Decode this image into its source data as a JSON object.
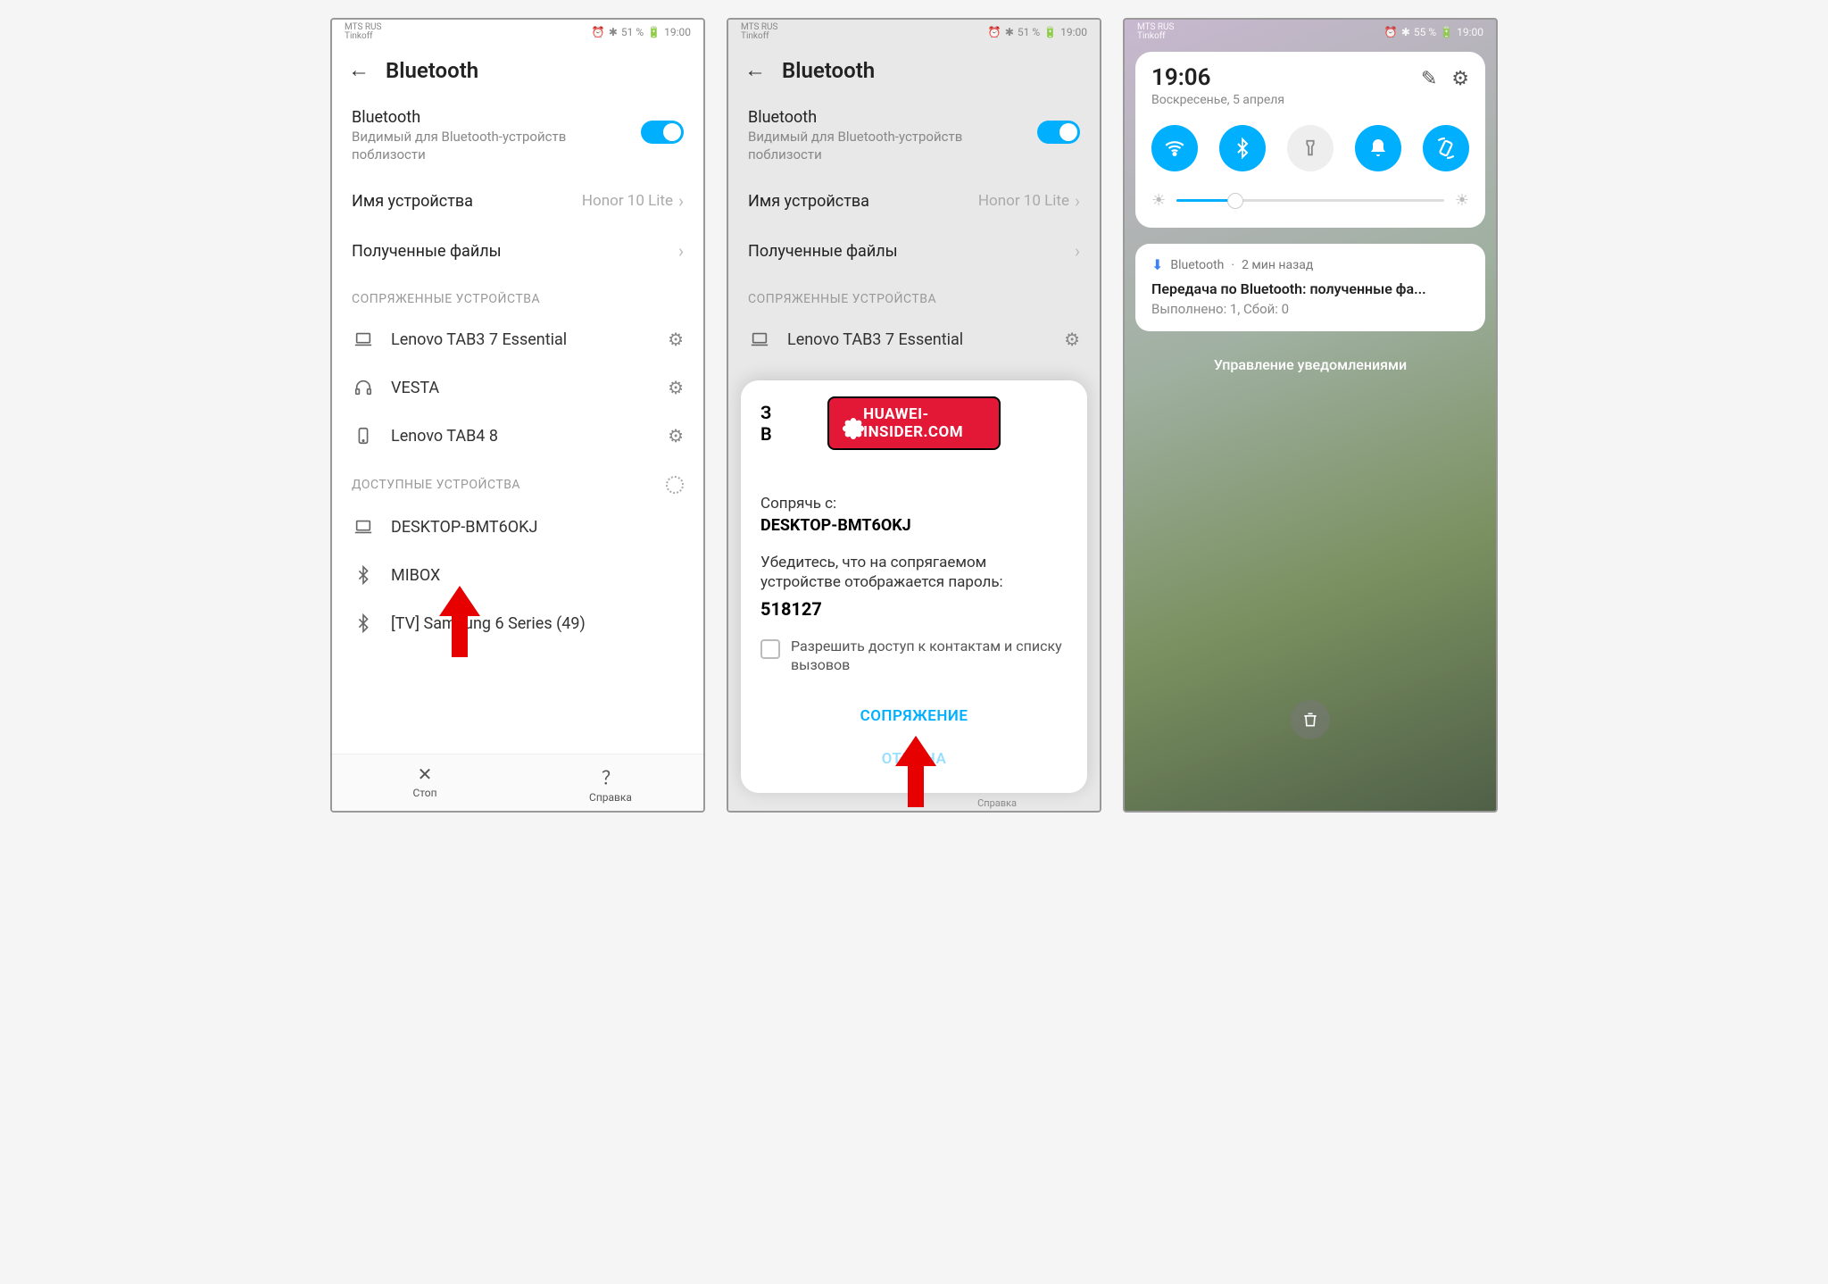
{
  "statusbar": {
    "carrier": "MTS RUS",
    "carrier2": "Tinkoff",
    "battery": "51 %",
    "battery3": "55 %",
    "time": "19:00"
  },
  "screen1": {
    "title": "Bluetooth",
    "toggle_title": "Bluetooth",
    "toggle_sub": "Видимый для Bluetooth-устройств поблизости",
    "device_name_label": "Имя устройства",
    "device_name_value": "Honor 10 Lite",
    "received_files": "Полученные файлы",
    "paired_header": "СОПРЯЖЕННЫЕ УСТРОЙСТВА",
    "paired": [
      {
        "name": "Lenovo TAB3 7 Essential",
        "icon": "laptop"
      },
      {
        "name": "VESTA",
        "icon": "headphones"
      },
      {
        "name": "Lenovo TAB4 8",
        "icon": "phone"
      }
    ],
    "available_header": "ДОСТУПНЫЕ УСТРОЙСТВА",
    "available": [
      {
        "name": "DESKTOP-BMT6OKJ",
        "icon": "laptop"
      },
      {
        "name": "MIBOX",
        "icon": "bt"
      },
      {
        "name": "[TV] Samsung 6 Series (49)",
        "icon": "bt"
      }
    ],
    "stop": "Стоп",
    "help": "Справка"
  },
  "screen2": {
    "dialog_prefix": "З",
    "dialog_prefix2": "B",
    "pair_with": "Сопрячь с:",
    "pair_device": "DESKTOP-BMT6OKJ",
    "pair_hint": "Убедитесь, что на сопрягаемом устройстве отображается пароль:",
    "pair_code": "518127",
    "allow_contacts": "Разрешить доступ к контактам и списку вызовов",
    "pair_action": "СОПРЯЖЕНИЕ",
    "cancel_action": "ОТМЕНА",
    "watermark": "HUAWEI-INSIDER.COM",
    "bottom_help": "Справка"
  },
  "screen3": {
    "time": "19:06",
    "date": "Воскресенье, 5 апреля",
    "notif_source": "Bluetooth",
    "notif_age": "2 мин назад",
    "notif_title": "Передача по Bluetooth: полученные фа...",
    "notif_body": "Выполнено: 1, Сбой: 0",
    "manage": "Управление уведомлениями"
  }
}
